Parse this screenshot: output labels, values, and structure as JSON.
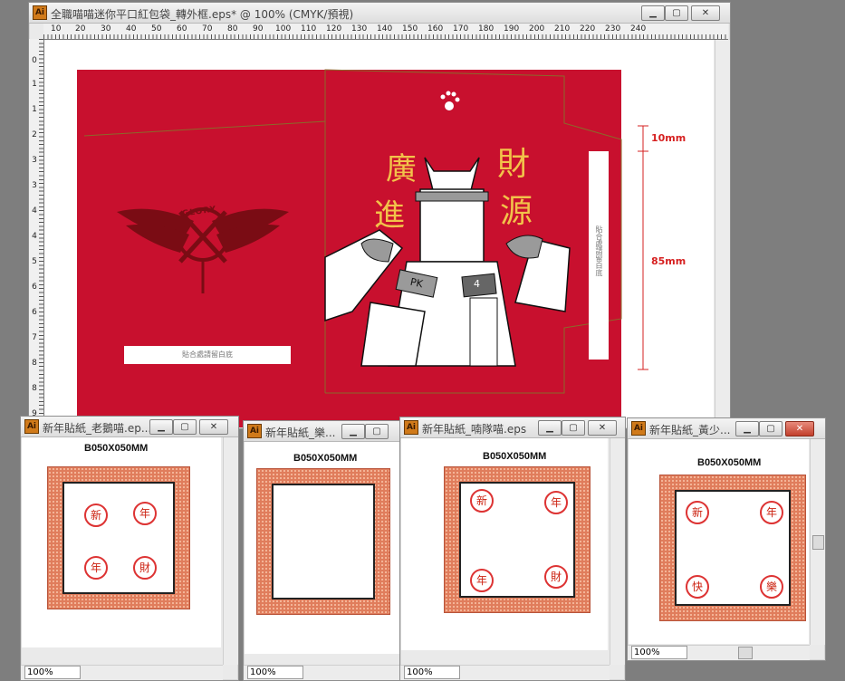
{
  "main_window": {
    "title": "全職喵喵迷你平口紅包袋_轉外框.eps* @ 100% (CMYK/預視)",
    "ruler_h": [
      "10",
      "20",
      "30",
      "40",
      "50",
      "60",
      "70",
      "80",
      "90",
      "100",
      "110",
      "120",
      "130",
      "140",
      "150",
      "160",
      "170",
      "180",
      "190",
      "200",
      "210",
      "220",
      "230",
      "240"
    ],
    "ruler_v": [
      "0",
      "1",
      "1",
      "2",
      "3",
      "3",
      "4",
      "4",
      "5",
      "6",
      "6",
      "7",
      "8",
      "8",
      "9"
    ],
    "envelope": {
      "back_label": "貼合處請留白底",
      "side_label": "貼合處請留白底",
      "emblem_text": "GLORY",
      "char_1": "廣",
      "char_2": "財",
      "char_3": "進",
      "char_4": "源",
      "sign_1": "PK",
      "sign_2": "4"
    },
    "dim_top": "10mm",
    "dim_bottom": "85mm"
  },
  "windows": [
    {
      "title": "新年貼紙_老鵝喵.ep...",
      "label": "B050X050MM",
      "zoom": "100%",
      "badges": [
        "新",
        "年",
        "年",
        "財"
      ]
    },
    {
      "title": "新年貼紙_樂...",
      "label": "B050X050MM",
      "zoom": "100%",
      "badges": []
    },
    {
      "title": "新年貼紙_喃隊喵.eps",
      "label": "B050X050MM",
      "zoom": "100%",
      "badges": [
        "新",
        "年",
        "年",
        "財"
      ]
    },
    {
      "title": "新年貼紙_黃少...",
      "label": "B050X050MM",
      "zoom": "100%",
      "badges": [
        "新",
        "年",
        "快",
        "樂"
      ]
    }
  ],
  "colors": {
    "envelope_red": "#c8102e",
    "gold": "#f2c24a",
    "dim_red": "#d62020"
  }
}
